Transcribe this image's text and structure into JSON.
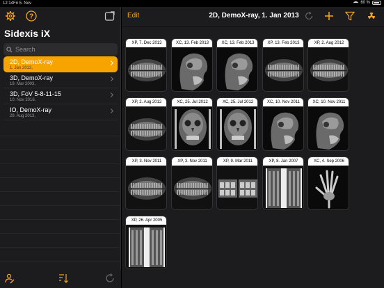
{
  "status": {
    "time": "12:14",
    "date": "Fri 5. Nov",
    "battery": "60 %"
  },
  "sidebar": {
    "title": "Sidexis iX",
    "search_placeholder": "Search",
    "patients": [
      {
        "name": "2D, DemoX-ray",
        "date": "1. Jan 2013,",
        "selected": true
      },
      {
        "name": "3D, DemoX-ray",
        "date": "19. Mar 2003,",
        "selected": false
      },
      {
        "name": "3D, FoV 5-8-11-15",
        "date": "10. Nov 2016,",
        "selected": false
      },
      {
        "name": "IO, DemoX-ray",
        "date": "29. Aug 2013,",
        "selected": false
      }
    ]
  },
  "main": {
    "edit_label": "Edit",
    "title": "2D, DemoX-ray, 1. Jan 2013",
    "tiles": [
      {
        "label": "XP, 7. Dec 2013",
        "kind": "pano"
      },
      {
        "label": "XC, 13. Feb 2013",
        "kind": "ceph-lat"
      },
      {
        "label": "XC, 13. Feb 2013",
        "kind": "ceph-lat"
      },
      {
        "label": "XP, 13. Feb 2013",
        "kind": "pano"
      },
      {
        "label": "XP, 2. Aug 2012",
        "kind": "pano"
      },
      {
        "label": "XP, 2. Aug 2012",
        "kind": "pano"
      },
      {
        "label": "XC, 25. Jul 2012",
        "kind": "ceph-pa"
      },
      {
        "label": "XC, 25. Jul 2012",
        "kind": "ceph-pa"
      },
      {
        "label": "XC, 10. Nov 2011",
        "kind": "ceph-lat"
      },
      {
        "label": "XC, 10. Nov 2011",
        "kind": "ceph-lat"
      },
      {
        "label": "XP, 3. Nov 2011",
        "kind": "pano"
      },
      {
        "label": "XP, 3. Nov 2011",
        "kind": "pano"
      },
      {
        "label": "XP, 9. Mar 2011",
        "kind": "bitewing"
      },
      {
        "label": "XP, 8. Jan 2007",
        "kind": "segments"
      },
      {
        "label": "XC, 4. Sep 2006",
        "kind": "hand"
      },
      {
        "label": "XP, 26. Apr 2005",
        "kind": "segments"
      }
    ]
  },
  "colors": {
    "accent": "#f5a623",
    "selected": "#f7a400"
  }
}
